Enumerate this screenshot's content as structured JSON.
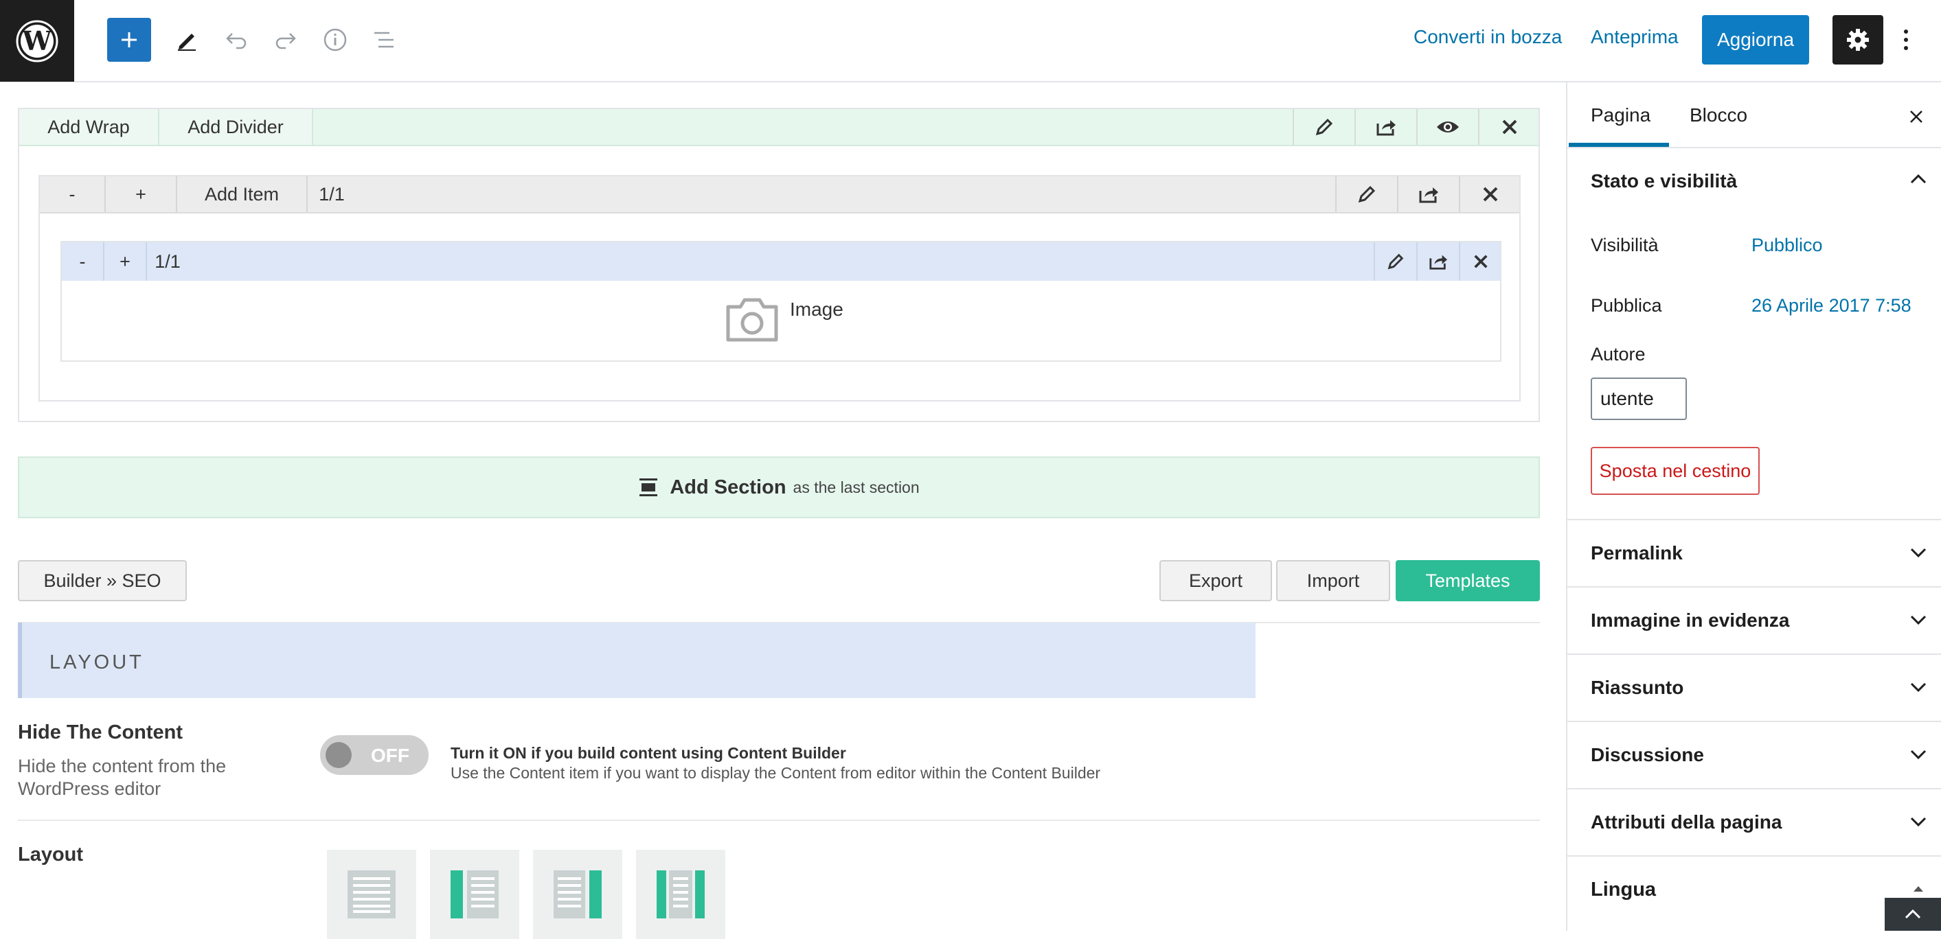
{
  "topbar": {
    "switch_to_draft": "Converti in bozza",
    "preview": "Anteprima",
    "update": "Aggiorna"
  },
  "builder": {
    "wrap_bar": {
      "add_wrap": "Add Wrap",
      "add_divider": "Add Divider"
    },
    "item_bar": {
      "minus": "-",
      "plus": "+",
      "add_item": "Add Item",
      "size": "1/1"
    },
    "column_bar": {
      "minus": "-",
      "plus": "+",
      "size": "1/1"
    },
    "image_label": "Image",
    "add_section": {
      "main": "Add Section",
      "sub": "as the last section"
    },
    "buttons": {
      "builder_seo": "Builder » SEO",
      "export": "Export",
      "import": "Import",
      "templates": "Templates"
    }
  },
  "options": {
    "layout_heading": "LAYOUT",
    "hide_content": {
      "title": "Hide The Content",
      "description": "Hide the content from the WordPress editor",
      "toggle": "OFF",
      "hint_bold": "Turn it ON if you build content using Content Builder",
      "hint": "Use the Content item if you want to display the Content from editor within the Content Builder"
    },
    "layout_title": "Layout"
  },
  "sidebar": {
    "tabs": [
      "Pagina",
      "Blocco"
    ],
    "status_panel": {
      "title": "Stato e visibilità",
      "visibility_label": "Visibilità",
      "visibility_value": "Pubblico",
      "publish_label": "Pubblica",
      "publish_value": "26 Aprile 2017 7:58",
      "author_label": "Autore",
      "author_value": "utente",
      "trash": "Sposta nel cestino"
    },
    "panels": [
      "Permalink",
      "Immagine in evidenza",
      "Riassunto",
      "Discussione",
      "Attributi della pagina",
      "Lingua"
    ]
  },
  "colors": {
    "wp_blue": "#0073aa",
    "update_button": "#0e7cc2",
    "templates_green": "#2dbd96",
    "trash_red": "#cc1818"
  },
  "icons": [
    "wordpress-logo",
    "plus-icon",
    "pencil-icon",
    "undo-icon",
    "redo-icon",
    "info-icon",
    "outline-icon",
    "gear-icon",
    "more-vertical-icon",
    "edit-icon",
    "share-icon",
    "eye-icon",
    "close-icon",
    "camera-icon",
    "section-icon",
    "chevron-up-icon",
    "chevron-down-icon"
  ]
}
